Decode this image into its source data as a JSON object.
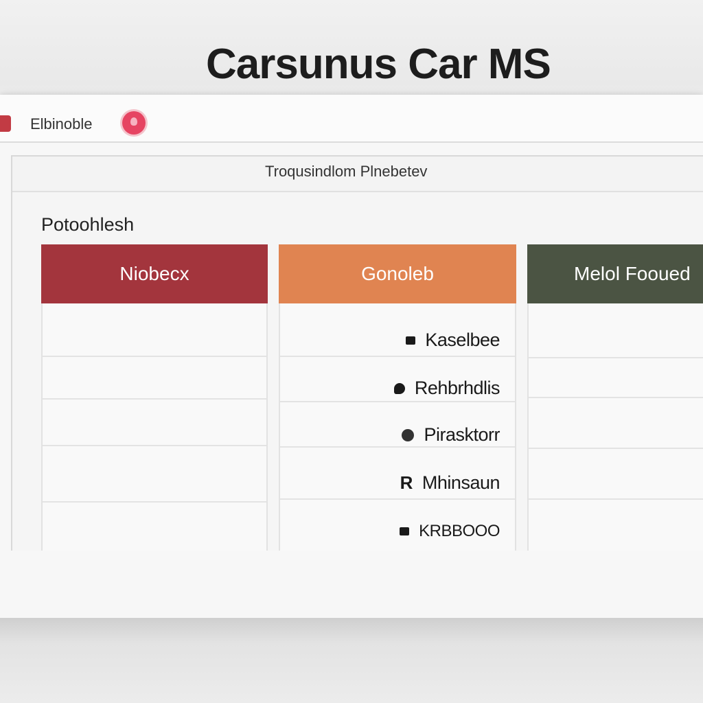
{
  "app": {
    "title": "Carsunus Car MS"
  },
  "topbar": {
    "brand_label": "Elbinoble",
    "brand_icon": "car-icon",
    "notification_icon": "notification-icon",
    "accent_color": "#e64462"
  },
  "panel": {
    "title": "Troqusindlom Plnebetev",
    "section_label": "Potoohlesh"
  },
  "columns": [
    {
      "label": "Niobecx",
      "color": "#a3353d"
    },
    {
      "label": "Gonoleb",
      "color": "#e08451"
    },
    {
      "label": "Melol Fooued",
      "color": "#4b5443"
    }
  ],
  "items": [
    {
      "marker": "square-bullet",
      "label": "Kaselbee"
    },
    {
      "marker": "bubble-bullet",
      "label": "Rehbrhdlis"
    },
    {
      "marker": "circle-bullet",
      "label": "Pirasktorr"
    },
    {
      "marker": "R",
      "label": "Mhinsaun"
    },
    {
      "marker": "square-bullet",
      "label": "KRBBOOO"
    }
  ]
}
